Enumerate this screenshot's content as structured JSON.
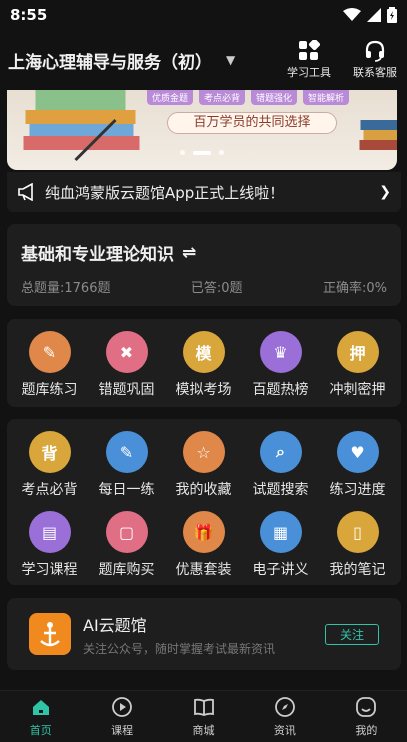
{
  "status": {
    "time": "8:55"
  },
  "header": {
    "title": "上海心理辅导与服务（初）",
    "study_tools": "学习工具",
    "contact_service": "联系客服"
  },
  "banner": {
    "tags": [
      "优质金题",
      "考点必背",
      "错题强化",
      "智能解析"
    ],
    "slogan": "百万学员的共同选择"
  },
  "notice": {
    "text": "纯血鸿蒙版云题馆App正式上线啦！"
  },
  "subject": {
    "title": "基础和专业理论知识",
    "total": "总题量:1766题",
    "answered": "已答:0题",
    "accuracy": "正确率:0%"
  },
  "quick": [
    {
      "label": "题库练习",
      "color": "#e0884a",
      "glyph": "✎"
    },
    {
      "label": "错题巩固",
      "color": "#e06f86",
      "glyph": "✖"
    },
    {
      "label": "模拟考场",
      "color": "#d8a63a",
      "glyph": "模"
    },
    {
      "label": "百题热榜",
      "color": "#9a6fd8",
      "glyph": "♛"
    },
    {
      "label": "冲刺密押",
      "color": "#d8a63a",
      "glyph": "押"
    }
  ],
  "tools": [
    {
      "label": "考点必背",
      "color": "#d8a63a",
      "glyph": "背"
    },
    {
      "label": "每日一练",
      "color": "#4a90d8",
      "glyph": "✎"
    },
    {
      "label": "我的收藏",
      "color": "#e0884a",
      "glyph": "☆"
    },
    {
      "label": "试题搜索",
      "color": "#4a90d8",
      "glyph": "⌕"
    },
    {
      "label": "练习进度",
      "color": "#4a90d8",
      "glyph": "♥"
    },
    {
      "label": "学习课程",
      "color": "#9a6fd8",
      "glyph": "▤"
    },
    {
      "label": "题库购买",
      "color": "#e06f86",
      "glyph": "▢"
    },
    {
      "label": "优惠套装",
      "color": "#e0884a",
      "glyph": "🎁"
    },
    {
      "label": "电子讲义",
      "color": "#4a90d8",
      "glyph": "▦"
    },
    {
      "label": "我的笔记",
      "color": "#d8a63a",
      "glyph": "▯"
    }
  ],
  "ai": {
    "name": "AI云题馆",
    "desc": "关注公众号，随时掌握考试最新资讯",
    "follow": "关注"
  },
  "tabs": [
    {
      "label": "首页",
      "icon": "home-icon"
    },
    {
      "label": "课程",
      "icon": "play-icon"
    },
    {
      "label": "商城",
      "icon": "book-icon"
    },
    {
      "label": "资讯",
      "icon": "compass-icon"
    },
    {
      "label": "我的",
      "icon": "profile-icon"
    }
  ],
  "colors": {
    "accent": "#2fc3a7",
    "background": "#121212",
    "card": "#1e1e1e"
  }
}
